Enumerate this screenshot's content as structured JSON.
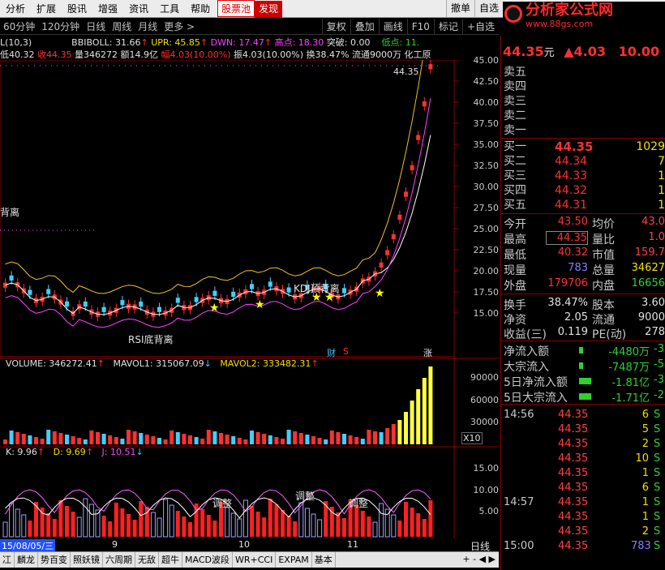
{
  "menu": {
    "items": [
      "分析",
      "扩展",
      "股讯",
      "增强",
      "资讯",
      "工具",
      "帮助"
    ],
    "stock_pool": "股票池",
    "discover": "发现",
    "right_items": [
      "撤单",
      "自选"
    ]
  },
  "logo": {
    "title": "分析家公式网",
    "url": "www.88gs.com"
  },
  "periods": [
    "60分钟",
    "120分钟",
    "日线",
    "周线",
    "月线",
    "更多 >"
  ],
  "tools": [
    "复权",
    "叠加",
    "画线",
    "F10",
    "标记",
    "+自选"
  ],
  "header_line1": {
    "prefix": "L(10,3)",
    "bbiboll": "BBIBOLL: 31.66",
    "upr": "UPR: 45.85",
    "dwn": "DWN: 17.47",
    "gaodian": "高点: 18.30",
    "tupo": "突破: 0.00",
    "didian": "低点: 11."
  },
  "header_line2": {
    "low": "低40.32",
    "close": "收44.35",
    "vol": "量346272",
    "amount": "额14.9亿",
    "range": "幅4.03(10.00%)",
    "amp": "振4.03(10.00%)",
    "turnover": "换38.47%",
    "float": "流通9000万",
    "industry": "化工原"
  },
  "price_axis": [
    "45.00",
    "42.50",
    "40.00",
    "37.50",
    "35.00",
    "32.50",
    "30.00",
    "27.50",
    "25.00",
    "22.50",
    "20.00",
    "17.50",
    "15.00"
  ],
  "annotations": {
    "top_price": "44.35",
    "beili": "背离",
    "kdj": "KDJ顶背离",
    "rsi": "RSI底背离",
    "cai": "财",
    "s": "S",
    "zhangting": "涨"
  },
  "volume_header": {
    "volume": "VOLUME: 346272.41",
    "mavol1": "MAVOL1: 315067.09",
    "mavol2": "MAVOL2: 333482.31"
  },
  "volume_axis": [
    "90000",
    "60000",
    "30000"
  ],
  "volume_unit": "X10",
  "kdj_header": {
    "k": "K: 9.96",
    "d": "D: 9.69",
    "j": "J: 10.51"
  },
  "kdj_axis": [
    "15.00",
    "10.00",
    "5.00"
  ],
  "kdj_labels": [
    "调整",
    "调整",
    "调整"
  ],
  "date_axis": {
    "first": "15/08/05/三",
    "ticks": [
      "9",
      "10",
      "11"
    ],
    "period": "日线"
  },
  "bottom_tabs": [
    "冮",
    "麟龙",
    "势百变",
    "照妖镜",
    "六周期",
    "无敌",
    "超牛",
    "MACD波段",
    "WR+CCI",
    "EXPAM",
    "基本"
  ],
  "quote": {
    "price": "44.35",
    "unit": "元",
    "change": "▲4.03",
    "pct": "10.00",
    "sells": [
      {
        "label": "卖五",
        "price": "",
        "vol": ""
      },
      {
        "label": "卖四",
        "price": "",
        "vol": ""
      },
      {
        "label": "卖三",
        "price": "",
        "vol": ""
      },
      {
        "label": "卖二",
        "price": "",
        "vol": ""
      },
      {
        "label": "卖一",
        "price": "",
        "vol": ""
      }
    ],
    "buys": [
      {
        "label": "买一",
        "price": "44.35",
        "vol": "1029"
      },
      {
        "label": "买二",
        "price": "44.34",
        "vol": "7"
      },
      {
        "label": "买三",
        "price": "44.33",
        "vol": "1"
      },
      {
        "label": "买四",
        "price": "44.32",
        "vol": "1"
      },
      {
        "label": "买五",
        "price": "44.31",
        "vol": "1"
      }
    ],
    "stats": [
      {
        "l1": "今开",
        "v1": "43.50",
        "l2": "均价",
        "v2": "43.0"
      },
      {
        "l1": "最高",
        "v1": "44.35",
        "l2": "量比",
        "v2": "1.0"
      },
      {
        "l1": "最低",
        "v1": "40.32",
        "l2": "市值",
        "v2": "159.7"
      },
      {
        "l1": "现量",
        "v1": "783",
        "l2": "总量",
        "v2": "34627"
      },
      {
        "l1": "外盘",
        "v1": "179706",
        "l2": "内盘",
        "v2": "16656"
      }
    ],
    "stats2": [
      {
        "l1": "换手",
        "v1": "38.47%",
        "l2": "股本",
        "v2": "3.60"
      },
      {
        "l1": "净资",
        "v1": "2.05",
        "l2": "流通",
        "v2": "9000"
      },
      {
        "l1": "收益(三)",
        "v1": "0.119",
        "l2": "PE(动)",
        "v2": "278"
      }
    ],
    "flows": [
      {
        "label": "净流入额",
        "value": "-4480万",
        "tail": "-3"
      },
      {
        "label": "大宗流入",
        "value": "-7487万",
        "tail": "-5"
      },
      {
        "label": "5日净流入额",
        "value": "-1.81亿",
        "tail": "-3"
      },
      {
        "label": "5日大宗流入",
        "value": "-1.71亿",
        "tail": "-2"
      }
    ],
    "ticks": [
      {
        "t": "14:56",
        "p": "44.35",
        "n": "6",
        "s": "S"
      },
      {
        "t": "",
        "p": "44.35",
        "n": "5",
        "s": "S"
      },
      {
        "t": "",
        "p": "44.35",
        "n": "2",
        "s": "S"
      },
      {
        "t": "",
        "p": "44.35",
        "n": "10",
        "s": "S"
      },
      {
        "t": "",
        "p": "44.35",
        "n": "1",
        "s": "S"
      },
      {
        "t": "",
        "p": "44.35",
        "n": "6",
        "s": "S"
      },
      {
        "t": "14:57",
        "p": "44.35",
        "n": "1",
        "s": "S"
      },
      {
        "t": "",
        "p": "44.35",
        "n": "1",
        "s": "S"
      },
      {
        "t": "",
        "p": "44.35",
        "n": "2",
        "s": "S"
      },
      {
        "t": "15:00",
        "p": "44.35",
        "n": "783",
        "s": "S"
      }
    ]
  }
}
